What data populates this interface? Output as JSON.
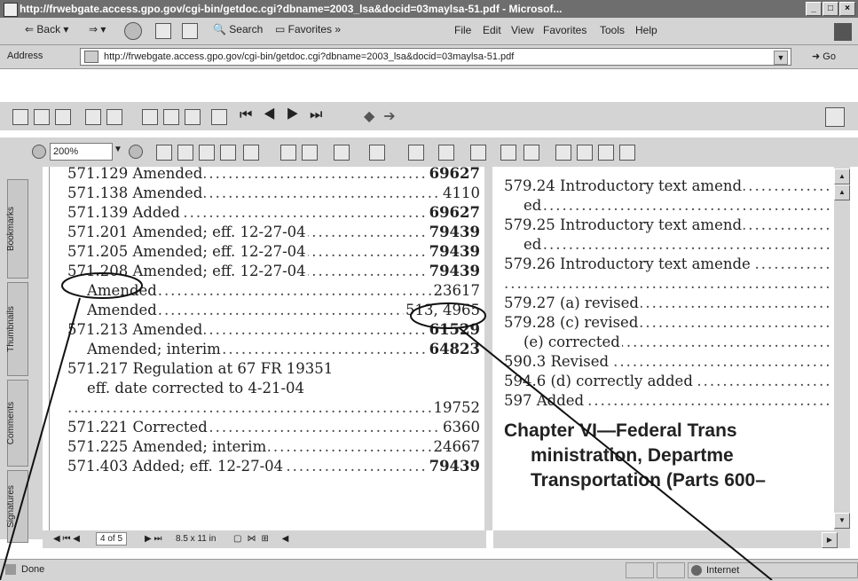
{
  "window": {
    "title": "http://frwebgate.access.gpo.gov/cgi-bin/getdoc.cgi?dbname=2003_lsa&docid=03maylsa-51.pdf - Microsof..."
  },
  "menubar": {
    "back": "Back",
    "search": "Search",
    "favorites": "Favorites",
    "items": [
      "File",
      "Edit",
      "View",
      "Favorites",
      "Tools",
      "Help"
    ]
  },
  "address": {
    "label": "Address",
    "url": "http://frwebgate.access.gpo.gov/cgi-bin/getdoc.cgi?dbname=2003_lsa&docid=03maylsa-51.pdf",
    "go": "Go"
  },
  "zoom": "200%",
  "side_tabs": [
    "Bookmarks",
    "Thumbnails",
    "Comments",
    "Signatures"
  ],
  "left_entries": [
    {
      "text": "571.129 Amended",
      "page": "69627",
      "bold": true
    },
    {
      "text": "571.138 Amended",
      "page": "4110",
      "bold": false
    },
    {
      "text": "571.139 Added",
      "page": "69627",
      "bold": true
    },
    {
      "text": "571.201 Amended; eff. 12-27-04",
      "page": "79439",
      "bold": true
    },
    {
      "text": "571.205 Amended; eff. 12-27-04",
      "page": "79439",
      "bold": true
    },
    {
      "text": "571.208 Amended; eff. 12-27-04",
      "page": "79439",
      "bold": true
    },
    {
      "text": "Amended",
      "page": "23617",
      "bold": false
    },
    {
      "text": "Amended",
      "page": "513, 4965",
      "bold": false
    },
    {
      "text": "571.213 Amended",
      "page": "61529",
      "bold": true
    },
    {
      "text": "Amended; interim",
      "page": "64823",
      "bold": true
    },
    {
      "text": "571.217 Regulation at 67 FR 19351",
      "page": "",
      "bold": false
    },
    {
      "text": "eff. date corrected to 4-21-04",
      "page": "",
      "bold": false
    },
    {
      "text": "",
      "page": "19752",
      "bold": false
    },
    {
      "text": "571.221 Corrected",
      "page": "6360",
      "bold": false
    },
    {
      "text": "571.225 Amended; interim",
      "page": "24667",
      "bold": false
    },
    {
      "text": "571.403 Added; eff. 12-27-04",
      "page": "79439",
      "bold": true
    }
  ],
  "right_entries": [
    {
      "text": "579.24 Introductory text amend"
    },
    {
      "text": "ed"
    },
    {
      "text": "579.25 Introductory text amend"
    },
    {
      "text": "ed"
    },
    {
      "text": "579.26 Introductory text amende"
    },
    {
      "text": ""
    },
    {
      "text": "579.27 (a) revised"
    },
    {
      "text": "579.28 (c) revised"
    },
    {
      "text": "(e) corrected"
    },
    {
      "text": "590.3 Revised"
    },
    {
      "text": "594.6 (d) correctly added"
    },
    {
      "text": "597 Added"
    }
  ],
  "chapter_heading": [
    "Chapter VI—Federal Trans",
    "ministration, Departme",
    "Transportation (Parts 600–"
  ],
  "page_nav": {
    "page": "4 of 5",
    "size": "8.5 x 11 in"
  },
  "status": {
    "left": "Done",
    "zone": "Internet"
  }
}
